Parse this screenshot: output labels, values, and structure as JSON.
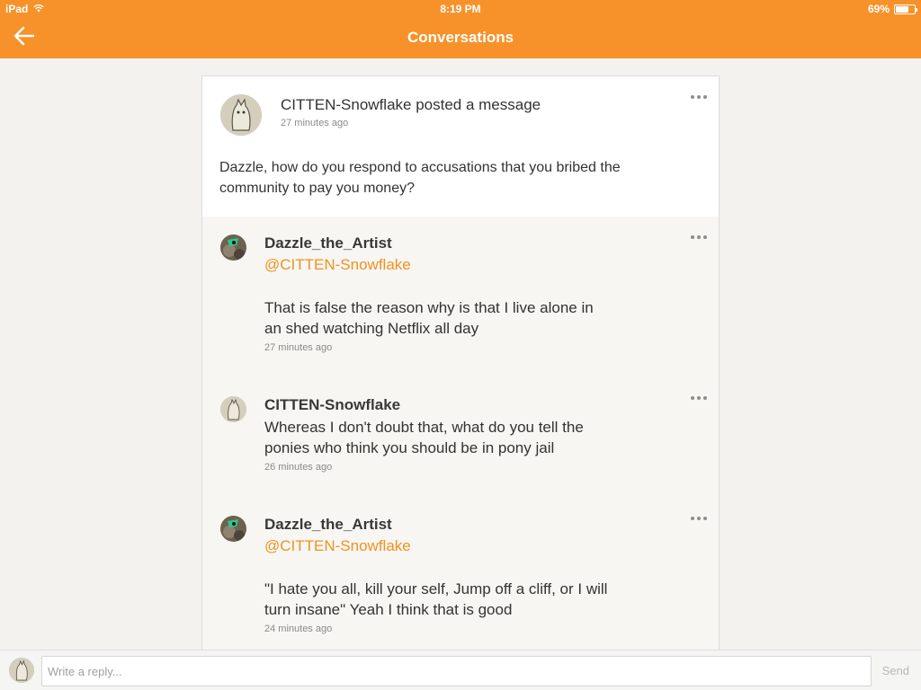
{
  "status": {
    "device": "iPad",
    "time": "8:19 PM",
    "battery": "69%",
    "battery_level": 0.69
  },
  "nav": {
    "title": "Conversations"
  },
  "post": {
    "header": "CITTEN-Snowflake posted a message",
    "time": "27 minutes ago",
    "body": "Dazzle, how do you respond to accusations that you bribed the community to pay you money?"
  },
  "replies": [
    {
      "author": "Dazzle_the_Artist",
      "mention": "@CITTEN-Snowflake",
      "text": "That is false the reason why is that I live alone in an shed watching Netflix all day",
      "time": "27 minutes ago"
    },
    {
      "author": "CITTEN-Snowflake",
      "text": "Whereas I don't doubt that, what do you tell the ponies who think you should be in pony jail",
      "time": "26 minutes ago"
    },
    {
      "author": "Dazzle_the_Artist",
      "mention": "@CITTEN-Snowflake",
      "text": "\"I hate you all, kill your self, Jump off a cliff, or I will turn insane\" Yeah I think that is good",
      "time": "24 minutes ago"
    }
  ],
  "composer": {
    "placeholder": "Write a reply...",
    "send_label": "Send"
  },
  "colors": {
    "accent": "#f7922a",
    "mention": "#f0921f",
    "background": "#f3f2ef"
  },
  "icons": {
    "back": "arrow-left-icon",
    "more": "ellipsis-icon",
    "wifi": "wifi-icon",
    "battery": "battery-icon"
  }
}
